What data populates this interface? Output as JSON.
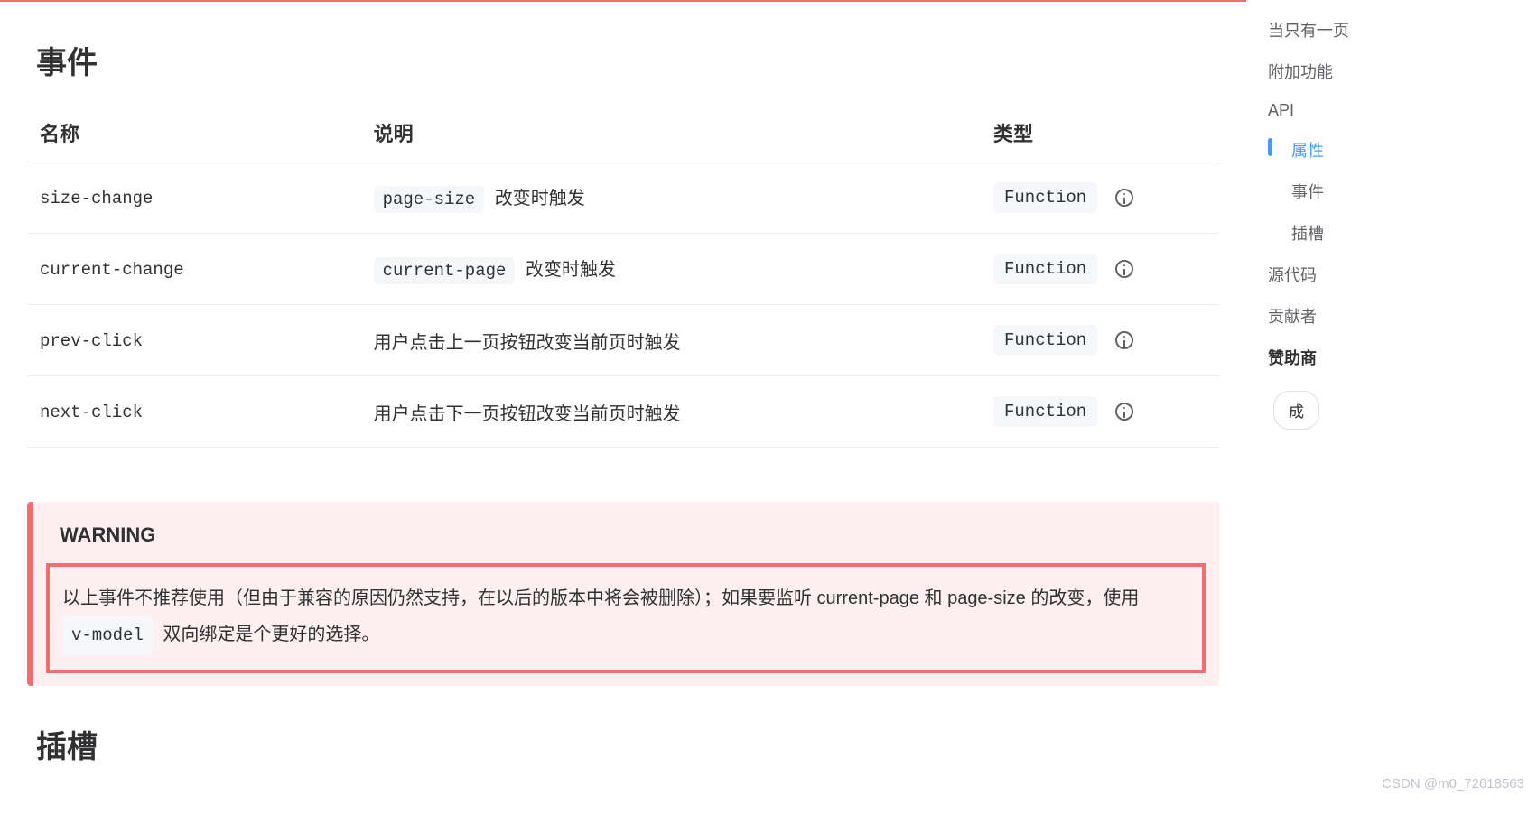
{
  "section": {
    "heading": "事件",
    "next_heading": "插槽"
  },
  "table": {
    "headers": {
      "name": "名称",
      "desc": "说明",
      "type": "类型"
    },
    "rows": [
      {
        "name": "size-change",
        "desc_code": "page-size",
        "desc_text": "改变时触发",
        "type": "Function"
      },
      {
        "name": "current-change",
        "desc_code": "current-page",
        "desc_text": "改变时触发",
        "type": "Function"
      },
      {
        "name": "prev-click",
        "desc_code": "",
        "desc_text": "用户点击上一页按钮改变当前页时触发",
        "type": "Function"
      },
      {
        "name": "next-click",
        "desc_code": "",
        "desc_text": "用户点击下一页按钮改变当前页时触发",
        "type": "Function"
      }
    ]
  },
  "warning": {
    "title": "WARNING",
    "text_pre": "以上事件不推荐使用（但由于兼容的原因仍然支持，在以后的版本中将会被删除）；如果要监听 current-page 和 page-size 的改变，使用 ",
    "code": "v-model",
    "text_post": " 双向绑定是个更好的选择。"
  },
  "sidebar": {
    "items": [
      {
        "label": "当只有一页",
        "sub": false,
        "active": false,
        "bold": false
      },
      {
        "label": "附加功能",
        "sub": false,
        "active": false,
        "bold": false
      },
      {
        "label": "API",
        "sub": false,
        "active": false,
        "bold": false
      },
      {
        "label": "属性",
        "sub": true,
        "active": true,
        "bold": false
      },
      {
        "label": "事件",
        "sub": true,
        "active": false,
        "bold": false
      },
      {
        "label": "插槽",
        "sub": true,
        "active": false,
        "bold": false
      },
      {
        "label": "源代码",
        "sub": false,
        "active": false,
        "bold": false
      },
      {
        "label": "贡献者",
        "sub": false,
        "active": false,
        "bold": false
      },
      {
        "label": "赞助商",
        "sub": false,
        "active": false,
        "bold": true
      }
    ],
    "button": "成"
  },
  "watermark": "CSDN @m0_72618563"
}
